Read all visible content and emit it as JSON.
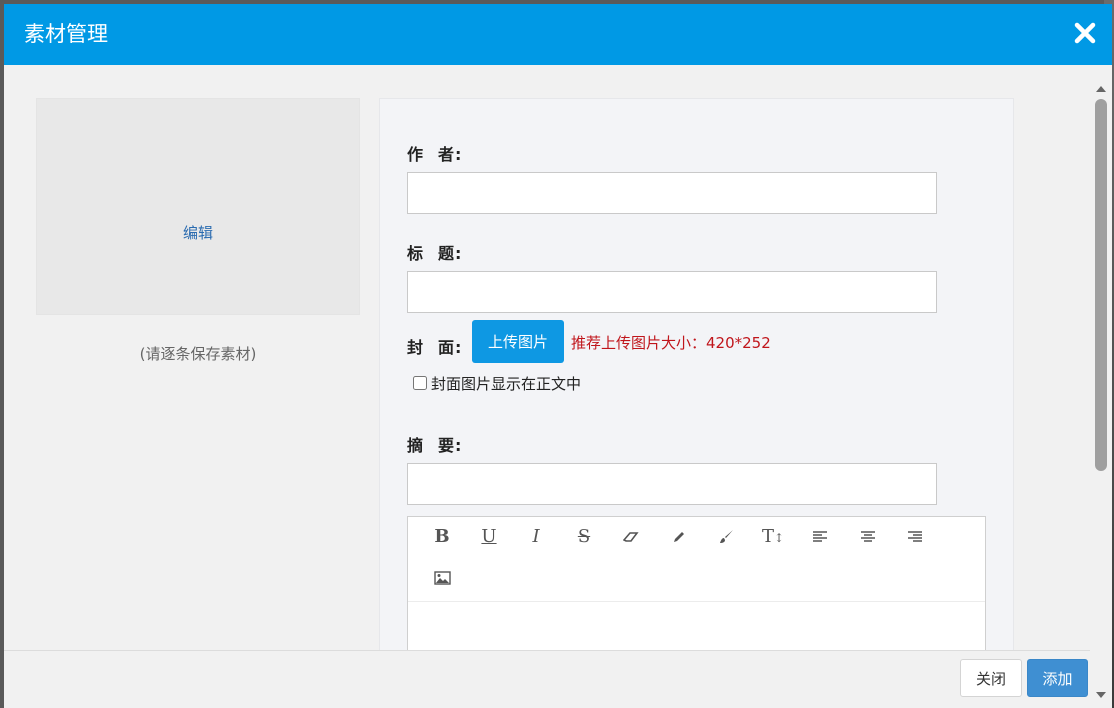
{
  "dialog": {
    "title": "素材管理",
    "close_icon": "close-icon"
  },
  "preview": {
    "edit_label": "编辑",
    "save_hint": "(请逐条保存素材)"
  },
  "form": {
    "author_label": [
      "作",
      "者:"
    ],
    "title_label": [
      "标",
      "题:"
    ],
    "cover_label": [
      "封",
      "面:"
    ],
    "summary_label": [
      "摘",
      "要:"
    ],
    "author_value": "",
    "title_value": "",
    "summary_value": "",
    "upload_button": "上传图片",
    "upload_tip": "推荐上传图片大小：420*252",
    "cover_in_body_label": "封面图片显示在正文中",
    "cover_in_body_checked": false
  },
  "editor": {
    "toolbar": [
      "bold-icon",
      "underline-icon",
      "italic-icon",
      "strikethrough-icon",
      "eraser-icon",
      "pencil-icon",
      "brush-icon",
      "text-height-icon",
      "align-left-icon",
      "align-center-icon",
      "align-right-icon",
      "image-icon"
    ]
  },
  "footer": {
    "close_button": "关闭",
    "add_button": "添加"
  },
  "colors": {
    "header": "#0099e5",
    "upload_button": "#0e98e3",
    "tip_text": "#c0151b",
    "add_button": "#3f8fd2"
  }
}
